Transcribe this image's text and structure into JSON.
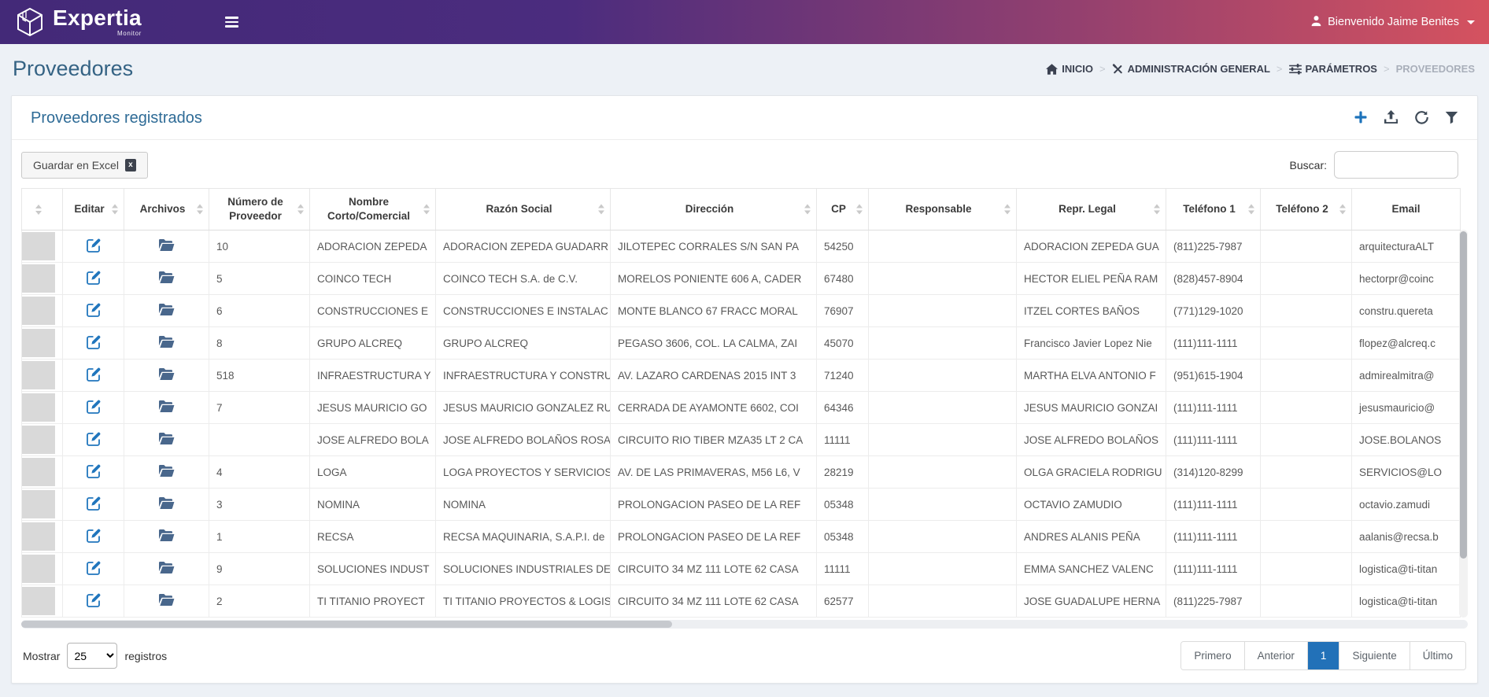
{
  "topbar": {
    "brand": "Expertia",
    "brand_tagline": "Monitor",
    "user_greeting": "Bienvenido Jaime Benites"
  },
  "page": {
    "title": "Proveedores",
    "breadcrumb": [
      {
        "label": "INICIO",
        "icon": "home-icon"
      },
      {
        "label": "ADMINISTRACIÓN GENERAL",
        "icon": "tools-icon"
      },
      {
        "label": "PARÁMETROS",
        "icon": "sliders-icon"
      },
      {
        "label": "PROVEEDORES",
        "icon": null
      }
    ]
  },
  "panel": {
    "title": "Proveedores registrados",
    "actions": [
      {
        "name": "add-provider-button",
        "icon": "plus-icon",
        "accent": true
      },
      {
        "name": "upload-button",
        "icon": "upload-icon",
        "accent": false
      },
      {
        "name": "refresh-button",
        "icon": "refresh-icon",
        "accent": false
      },
      {
        "name": "filter-button",
        "icon": "filter-icon",
        "accent": false
      }
    ]
  },
  "toolbar": {
    "excel_button": "Guardar en Excel",
    "search_label": "Buscar:",
    "search_value": ""
  },
  "table": {
    "columns": [
      {
        "key": "handle",
        "label": "",
        "sortable": true
      },
      {
        "key": "edit",
        "label": "Editar",
        "sortable": true
      },
      {
        "key": "files",
        "label": "Archivos",
        "sortable": true
      },
      {
        "key": "numero",
        "label": "Número de Proveedor",
        "sortable": true
      },
      {
        "key": "nombre",
        "label": "Nombre Corto/Comercial",
        "sortable": true
      },
      {
        "key": "razon",
        "label": "Razón Social",
        "sortable": true
      },
      {
        "key": "direccion",
        "label": "Dirección",
        "sortable": true
      },
      {
        "key": "cp",
        "label": "CP",
        "sortable": true
      },
      {
        "key": "responsable",
        "label": "Responsable",
        "sortable": true
      },
      {
        "key": "repr",
        "label": "Repr. Legal",
        "sortable": true
      },
      {
        "key": "tel1",
        "label": "Teléfono 1",
        "sortable": true
      },
      {
        "key": "tel2",
        "label": "Teléfono 2",
        "sortable": true
      },
      {
        "key": "email",
        "label": "Email",
        "sortable": false
      }
    ],
    "rows": [
      {
        "numero": "10",
        "nombre": "ADORACION ZEPEDA",
        "razon": "ADORACION ZEPEDA GUADARR",
        "direccion": "JILOTEPEC CORRALES S/N SAN PA",
        "cp": "54250",
        "responsable": "",
        "repr": "ADORACION ZEPEDA GUA",
        "tel1": "(811)225-7987",
        "tel2": "",
        "email": "arquitecturaALT"
      },
      {
        "numero": "5",
        "nombre": "COINCO TECH",
        "razon": "COINCO TECH S.A. de C.V.",
        "direccion": "MORELOS PONIENTE 606 A, CADER",
        "cp": "67480",
        "responsable": "",
        "repr": "HECTOR ELIEL PEÑA RAM",
        "tel1": "(828)457-8904",
        "tel2": "",
        "email": "hectorpr@coinc"
      },
      {
        "numero": "6",
        "nombre": "CONSTRUCCIONES E",
        "razon": "CONSTRUCCIONES E INSTALAC",
        "direccion": "MONTE BLANCO 67 FRACC MORAL",
        "cp": "76907",
        "responsable": "",
        "repr": "ITZEL CORTES BAÑOS",
        "tel1": "(771)129-1020",
        "tel2": "",
        "email": "constru.quereta"
      },
      {
        "numero": "8",
        "nombre": "GRUPO ALCREQ",
        "razon": "GRUPO ALCREQ",
        "direccion": "PEGASO 3606, COL. LA CALMA, ZAI",
        "cp": "45070",
        "responsable": "",
        "repr": "Francisco Javier Lopez Nie",
        "tel1": "(111)111-1111",
        "tel2": "",
        "email": "flopez@alcreq.c"
      },
      {
        "numero": "518",
        "nombre": "INFRAESTRUCTURA Y",
        "razon": "INFRAESTRUCTURA Y CONSTRU",
        "direccion": "AV. LAZARO CARDENAS 2015 INT 3",
        "cp": "71240",
        "responsable": "",
        "repr": "MARTHA ELVA ANTONIO F",
        "tel1": "(951)615-1904",
        "tel2": "",
        "email": "admirealmitra@"
      },
      {
        "numero": "7",
        "nombre": "JESUS MAURICIO GO",
        "razon": "JESUS MAURICIO GONZALEZ RU",
        "direccion": "CERRADA DE AYAMONTE 6602, COI",
        "cp": "64346",
        "responsable": "",
        "repr": "JESUS MAURICIO GONZAI",
        "tel1": "(111)111-1111",
        "tel2": "",
        "email": "jesusmauricio@"
      },
      {
        "numero": "",
        "nombre": "JOSE ALFREDO BOLA",
        "razon": "JOSE ALFREDO BOLAÑOS ROSA",
        "direccion": "CIRCUITO RIO TIBER MZA35 LT 2 CA",
        "cp": "11111",
        "responsable": "",
        "repr": "JOSE ALFREDO BOLAÑOS",
        "tel1": "(111)111-1111",
        "tel2": "",
        "email": "JOSE.BOLANOS"
      },
      {
        "numero": "4",
        "nombre": "LOGA",
        "razon": "LOGA PROYECTOS Y SERVICIOS",
        "direccion": "AV. DE LAS PRIMAVERAS, M56 L6, V",
        "cp": "28219",
        "responsable": "",
        "repr": "OLGA GRACIELA RODRIGU",
        "tel1": "(314)120-8299",
        "tel2": "",
        "email": "SERVICIOS@LO"
      },
      {
        "numero": "3",
        "nombre": "NOMINA",
        "razon": "NOMINA",
        "direccion": "PROLONGACION PASEO DE LA REF",
        "cp": "05348",
        "responsable": "",
        "repr": "OCTAVIO ZAMUDIO",
        "tel1": "(111)111-1111",
        "tel2": "",
        "email": "octavio.zamudi"
      },
      {
        "numero": "1",
        "nombre": "RECSA",
        "razon": "RECSA MAQUINARIA, S.A.P.I. de",
        "direccion": "PROLONGACION PASEO DE LA REF",
        "cp": "05348",
        "responsable": "",
        "repr": "ANDRES ALANIS PEÑA",
        "tel1": "(111)111-1111",
        "tel2": "",
        "email": "aalanis@recsa.b"
      },
      {
        "numero": "9",
        "nombre": "SOLUCIONES INDUST",
        "razon": "SOLUCIONES INDUSTRIALES DE",
        "direccion": "CIRCUITO 34 MZ 111 LOTE 62 CASA",
        "cp": "11111",
        "responsable": "",
        "repr": "EMMA SANCHEZ VALENC",
        "tel1": "(111)111-1111",
        "tel2": "",
        "email": "logistica@ti-titan"
      },
      {
        "numero": "2",
        "nombre": "TI TITANIO PROYECT",
        "razon": "TI TITANIO PROYECTOS & LOGIS",
        "direccion": "CIRCUITO 34 MZ 111 LOTE 62 CASA",
        "cp": "62577",
        "responsable": "",
        "repr": "JOSE GUADALUPE HERNA",
        "tel1": "(811)225-7987",
        "tel2": "",
        "email": "logistica@ti-titan"
      }
    ]
  },
  "footer": {
    "show_label": "Mostrar",
    "page_size": "25",
    "records_label": "registros",
    "pagination": {
      "buttons": [
        "Primero",
        "Anterior",
        "1",
        "Siguiente",
        "Último"
      ],
      "active": "1"
    }
  },
  "colors": {
    "brand_purple": "#432978",
    "brand_red": "#d5525f",
    "accent_blue": "#2271b8",
    "edit_icon_blue": "#2176bd",
    "folder_icon_blue": "#49678c"
  }
}
